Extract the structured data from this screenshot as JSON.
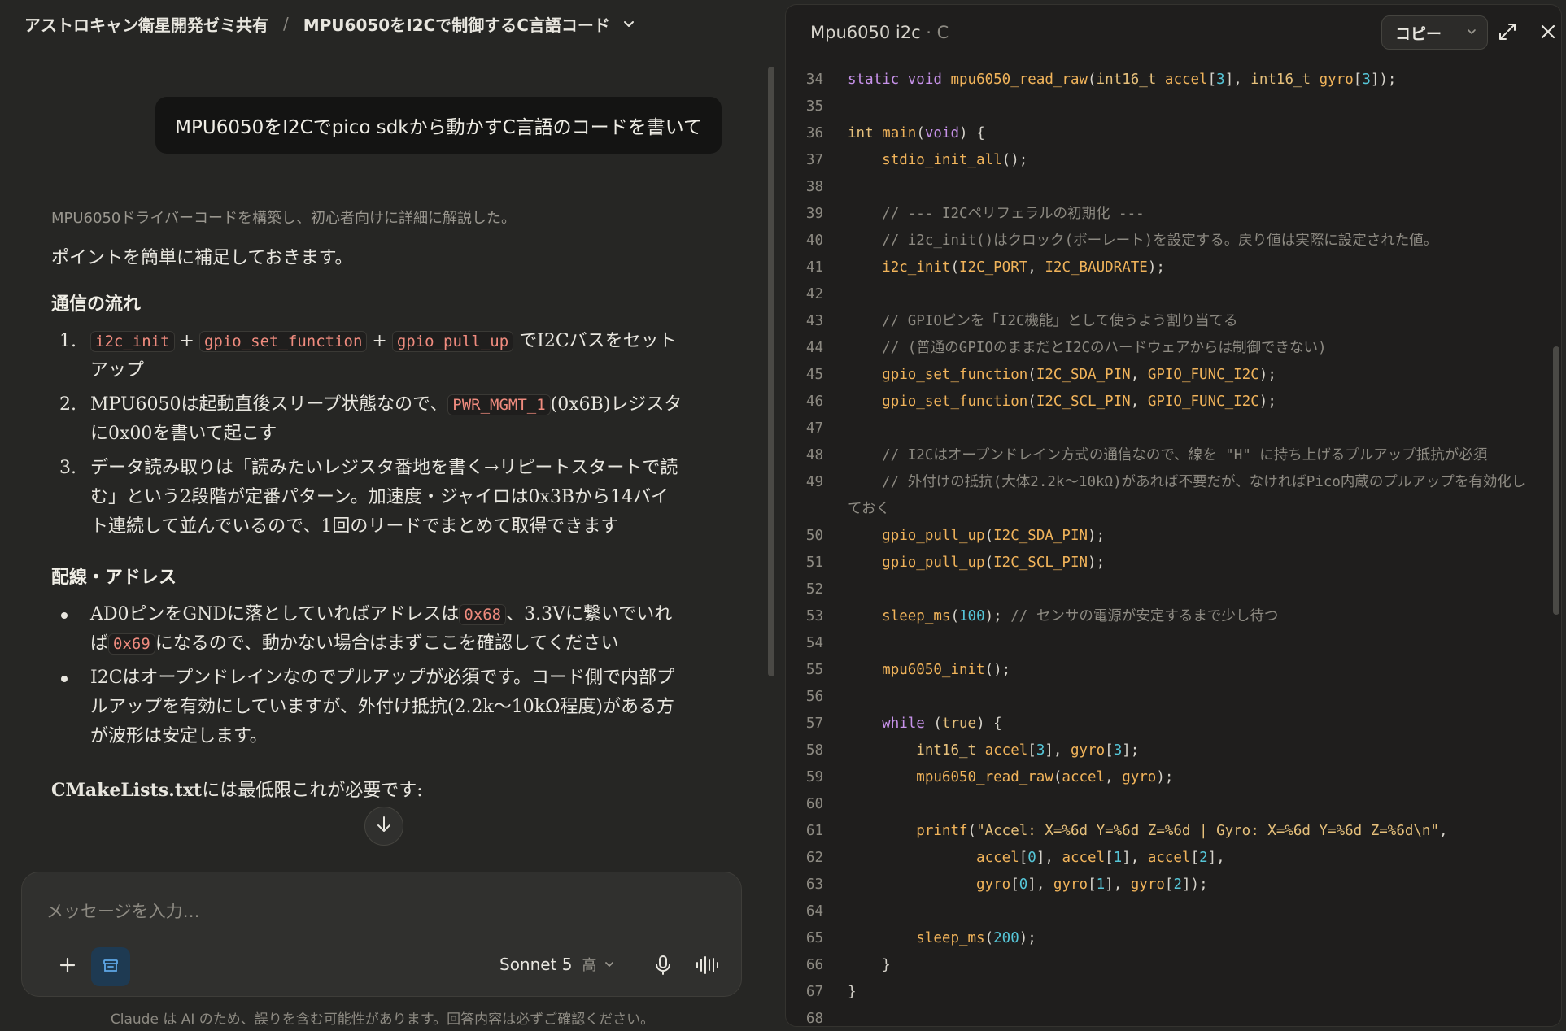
{
  "breadcrumb": {
    "project": "アストロキャン衛星開発ゼミ共有",
    "separator": "/",
    "chat_title": "MPU6050をI2Cで制御するC言語コード"
  },
  "user_message": "MPU6050をI2Cでpico sdkから動かすC言語のコードを書いて",
  "assistant": {
    "thinking_summary": "MPU6050ドライバーコードを構築し、初心者向けに詳細に解説した。",
    "intro": "ポイントを簡単に補足しておきます。",
    "section1_title": "通信の流れ",
    "section1_items": [
      {
        "num": "1.",
        "code_a": "i2c_init",
        "plus1": "+",
        "code_b": "gpio_set_function",
        "plus2": "+",
        "code_c": "gpio_pull_up",
        "text": " でI2Cバスをセットアップ"
      },
      {
        "num": "2.",
        "text_a": "MPU6050は起動直後スリープ状態なので、",
        "code": "PWR_MGMT_1",
        "text_b": "(0x6B)レジスタに0x00を書いて起こす"
      },
      {
        "num": "3.",
        "text": "データ読み取りは「読みたいレジスタ番地を書く→リピートスタートで読む」という2段階が定番パターン。加速度・ジャイロは0x3Bから14バイト連続して並んでいるので、1回のリードでまとめて取得できます"
      }
    ],
    "section2_title": "配線・アドレス",
    "section2_items": [
      {
        "text_a": "AD0ピンをGNDに落としていればアドレスは",
        "code_a": "0x68",
        "text_b": "、3.3Vに繋いでいれば",
        "code_b": "0x69",
        "text_c": "になるので、動かない場合はまずここを確認してください"
      },
      {
        "text": "I2Cはオープンドレインなのでプルアップが必須です。コード側で内部プルアップを有効にしていますが、外付け抵抗(2.2k〜10kΩ程度)がある方が波形は安定します。"
      }
    ],
    "trailing_fade_a": "CMakeLists.txt",
    "trailing_fade_b": "には最低限これが必要です:"
  },
  "composer": {
    "placeholder": "メッセージを入力…",
    "model_name": "Sonnet 5",
    "effort": "高"
  },
  "disclaimer": "Claude は AI のため、誤りを含む可能性があります。回答内容は必ずご確認ください。",
  "artifact": {
    "title": "Mpu6050 i2c",
    "lang_suffix": " · C",
    "copy_label": "コピー",
    "lines": [
      {
        "n": "34",
        "html": "<span class='tk-kw'>static</span> <span class='tk-kw'>void</span> <span class='tk-fn'>mpu6050_read_raw</span>(<span class='tk-ty'>int16_t</span> <span class='tk-var'>accel</span>[<span class='tk-num'>3</span>], <span class='tk-ty'>int16_t</span> <span class='tk-var'>gyro</span>[<span class='tk-num'>3</span>]);"
      },
      {
        "n": "35",
        "html": ""
      },
      {
        "n": "36",
        "html": "<span class='tk-ty'>int</span> <span class='tk-fn'>main</span>(<span class='tk-kw'>void</span>) {"
      },
      {
        "n": "37",
        "html": "    <span class='tk-fn'>stdio_init_all</span>();"
      },
      {
        "n": "38",
        "html": ""
      },
      {
        "n": "39",
        "html": "    <span class='tk-cm'>// --- I2Cペリフェラルの初期化 ---</span>"
      },
      {
        "n": "40",
        "html": "    <span class='tk-cm'>// i2c_init()はクロック(ボーレート)を設定する。戻り値は実際に設定された値。</span>"
      },
      {
        "n": "41",
        "html": "    <span class='tk-fn'>i2c_init</span>(<span class='tk-mac'>I2C_PORT</span>, <span class='tk-mac'>I2C_BAUDRATE</span>);"
      },
      {
        "n": "42",
        "html": ""
      },
      {
        "n": "43",
        "html": "    <span class='tk-cm'>// GPIOピンを「I2C機能」として使うよう割り当てる</span>"
      },
      {
        "n": "44",
        "html": "    <span class='tk-cm'>// (普通のGPIOのままだとI2Cのハードウェアからは制御できない)</span>"
      },
      {
        "n": "45",
        "html": "    <span class='tk-fn'>gpio_set_function</span>(<span class='tk-mac'>I2C_SDA_PIN</span>, <span class='tk-mac'>GPIO_FUNC_I2C</span>);"
      },
      {
        "n": "46",
        "html": "    <span class='tk-fn'>gpio_set_function</span>(<span class='tk-mac'>I2C_SCL_PIN</span>, <span class='tk-mac'>GPIO_FUNC_I2C</span>);"
      },
      {
        "n": "47",
        "html": ""
      },
      {
        "n": "48",
        "html": "    <span class='tk-cm'>// I2Cはオープンドレイン方式の通信なので、線を \"H\" に持ち上げるプルアップ抵抗が必須</span>"
      },
      {
        "n": "49",
        "html": "    <span class='tk-cm'>// 外付けの抵抗(大体2.2k〜10kΩ)があれば不要だが、なければPico内蔵のプルアップを有効化しておく</span>",
        "wrap": true
      },
      {
        "n": "50",
        "html": "    <span class='tk-fn'>gpio_pull_up</span>(<span class='tk-mac'>I2C_SDA_PIN</span>);"
      },
      {
        "n": "51",
        "html": "    <span class='tk-fn'>gpio_pull_up</span>(<span class='tk-mac'>I2C_SCL_PIN</span>);"
      },
      {
        "n": "52",
        "html": ""
      },
      {
        "n": "53",
        "html": "    <span class='tk-fn'>sleep_ms</span>(<span class='tk-num'>100</span>); <span class='tk-cm'>// センサの電源が安定するまで少し待つ</span>"
      },
      {
        "n": "54",
        "html": ""
      },
      {
        "n": "55",
        "html": "    <span class='tk-fn'>mpu6050_init</span>();"
      },
      {
        "n": "56",
        "html": ""
      },
      {
        "n": "57",
        "html": "    <span class='tk-kw'>while</span> (<span class='tk-ty'>true</span>) {"
      },
      {
        "n": "58",
        "html": "        <span class='tk-ty'>int16_t</span> <span class='tk-var'>accel</span>[<span class='tk-num'>3</span>], <span class='tk-var'>gyro</span>[<span class='tk-num'>3</span>];"
      },
      {
        "n": "59",
        "html": "        <span class='tk-fn'>mpu6050_read_raw</span>(<span class='tk-var'>accel</span>, <span class='tk-var'>gyro</span>);"
      },
      {
        "n": "60",
        "html": ""
      },
      {
        "n": "61",
        "html": "        <span class='tk-fn'>printf</span>(<span class='tk-str'>\"Accel: X=%6d Y=%6d Z=%6d | Gyro: X=%6d Y=%6d Z=%6d\\n\"</span>,"
      },
      {
        "n": "62",
        "html": "               <span class='tk-var'>accel</span>[<span class='tk-num'>0</span>], <span class='tk-var'>accel</span>[<span class='tk-num'>1</span>], <span class='tk-var'>accel</span>[<span class='tk-num'>2</span>],"
      },
      {
        "n": "63",
        "html": "               <span class='tk-var'>gyro</span>[<span class='tk-num'>0</span>], <span class='tk-var'>gyro</span>[<span class='tk-num'>1</span>], <span class='tk-var'>gyro</span>[<span class='tk-num'>2</span>]);"
      },
      {
        "n": "64",
        "html": ""
      },
      {
        "n": "65",
        "html": "        <span class='tk-fn'>sleep_ms</span>(<span class='tk-num'>200</span>);"
      },
      {
        "n": "66",
        "html": "    }"
      },
      {
        "n": "67",
        "html": "}"
      },
      {
        "n": "68",
        "html": ""
      }
    ]
  },
  "colors": {
    "background": "#262624",
    "artifact_bg": "#1f1e1d",
    "inline_code": "#ef8b7e",
    "accent_blue": "#1e3a52"
  }
}
